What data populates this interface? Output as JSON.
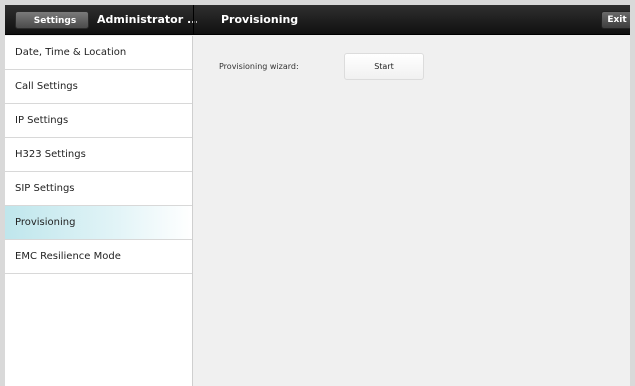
{
  "topbar": {
    "back_label": "Settings",
    "left_title": "Administrator ...",
    "main_title": "Provisioning",
    "exit_label": "Exit"
  },
  "sidebar": {
    "items": [
      {
        "label": "Date, Time & Location"
      },
      {
        "label": "Call Settings"
      },
      {
        "label": "IP Settings"
      },
      {
        "label": "H323 Settings"
      },
      {
        "label": "SIP Settings"
      },
      {
        "label": "Provisioning",
        "active": true
      },
      {
        "label": "EMC Resilience Mode"
      }
    ]
  },
  "content": {
    "wizard_label": "Provisioning wizard:",
    "start_label": "Start"
  },
  "colors": {
    "active_item": "#bfe6ec",
    "topbar": "#1c1c1c"
  }
}
